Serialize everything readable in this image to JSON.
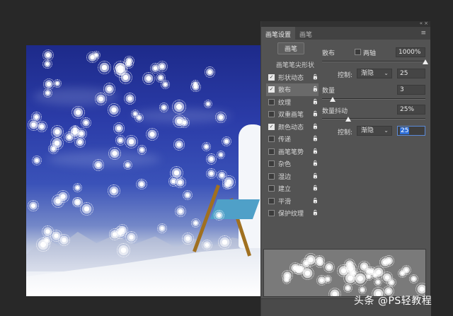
{
  "panel": {
    "tabs": [
      {
        "label": "画笔设置",
        "active": true
      },
      {
        "label": "画笔",
        "active": false
      }
    ],
    "preset_button": "画笔",
    "sidebar": [
      {
        "label": "画笔笔尖形状",
        "header": true
      },
      {
        "label": "形状动态",
        "checked": true,
        "locked": true
      },
      {
        "label": "散布",
        "checked": true,
        "locked": true,
        "selected": true
      },
      {
        "label": "纹理",
        "checked": false,
        "locked": true
      },
      {
        "label": "双重画笔",
        "checked": false,
        "locked": true
      },
      {
        "label": "颜色动态",
        "checked": true,
        "locked": true
      },
      {
        "label": "传递",
        "checked": false,
        "locked": true
      },
      {
        "label": "画笔笔势",
        "checked": false,
        "locked": true
      },
      {
        "label": "杂色",
        "checked": false,
        "locked": true
      },
      {
        "label": "湿边",
        "checked": false,
        "locked": true
      },
      {
        "label": "建立",
        "checked": false,
        "locked": true
      },
      {
        "label": "平滑",
        "checked": false,
        "locked": true
      },
      {
        "label": "保护纹理",
        "checked": false,
        "locked": true
      }
    ],
    "scatter": {
      "label": "散布",
      "both_axes_label": "两轴",
      "both_axes_checked": false,
      "value": "1000%",
      "slider_fraction": 1.0,
      "control_label": "控制:",
      "control_value": "渐隐",
      "control_number": "25"
    },
    "count": {
      "label": "数量",
      "value": "3",
      "slider_fraction": 0.1
    },
    "count_jitter": {
      "label": "数量抖动",
      "value": "25%",
      "slider_fraction": 0.25,
      "control_label": "控制:",
      "control_value": "渐隐",
      "control_number": "25"
    }
  },
  "watermark": "头条 @PS轻教程",
  "icons": {
    "lock": "lock-icon",
    "menu": "panel-menu-icon",
    "collapse": "double-chevron-icon",
    "close": "close-icon",
    "dropdown": "chevron-down-icon"
  }
}
